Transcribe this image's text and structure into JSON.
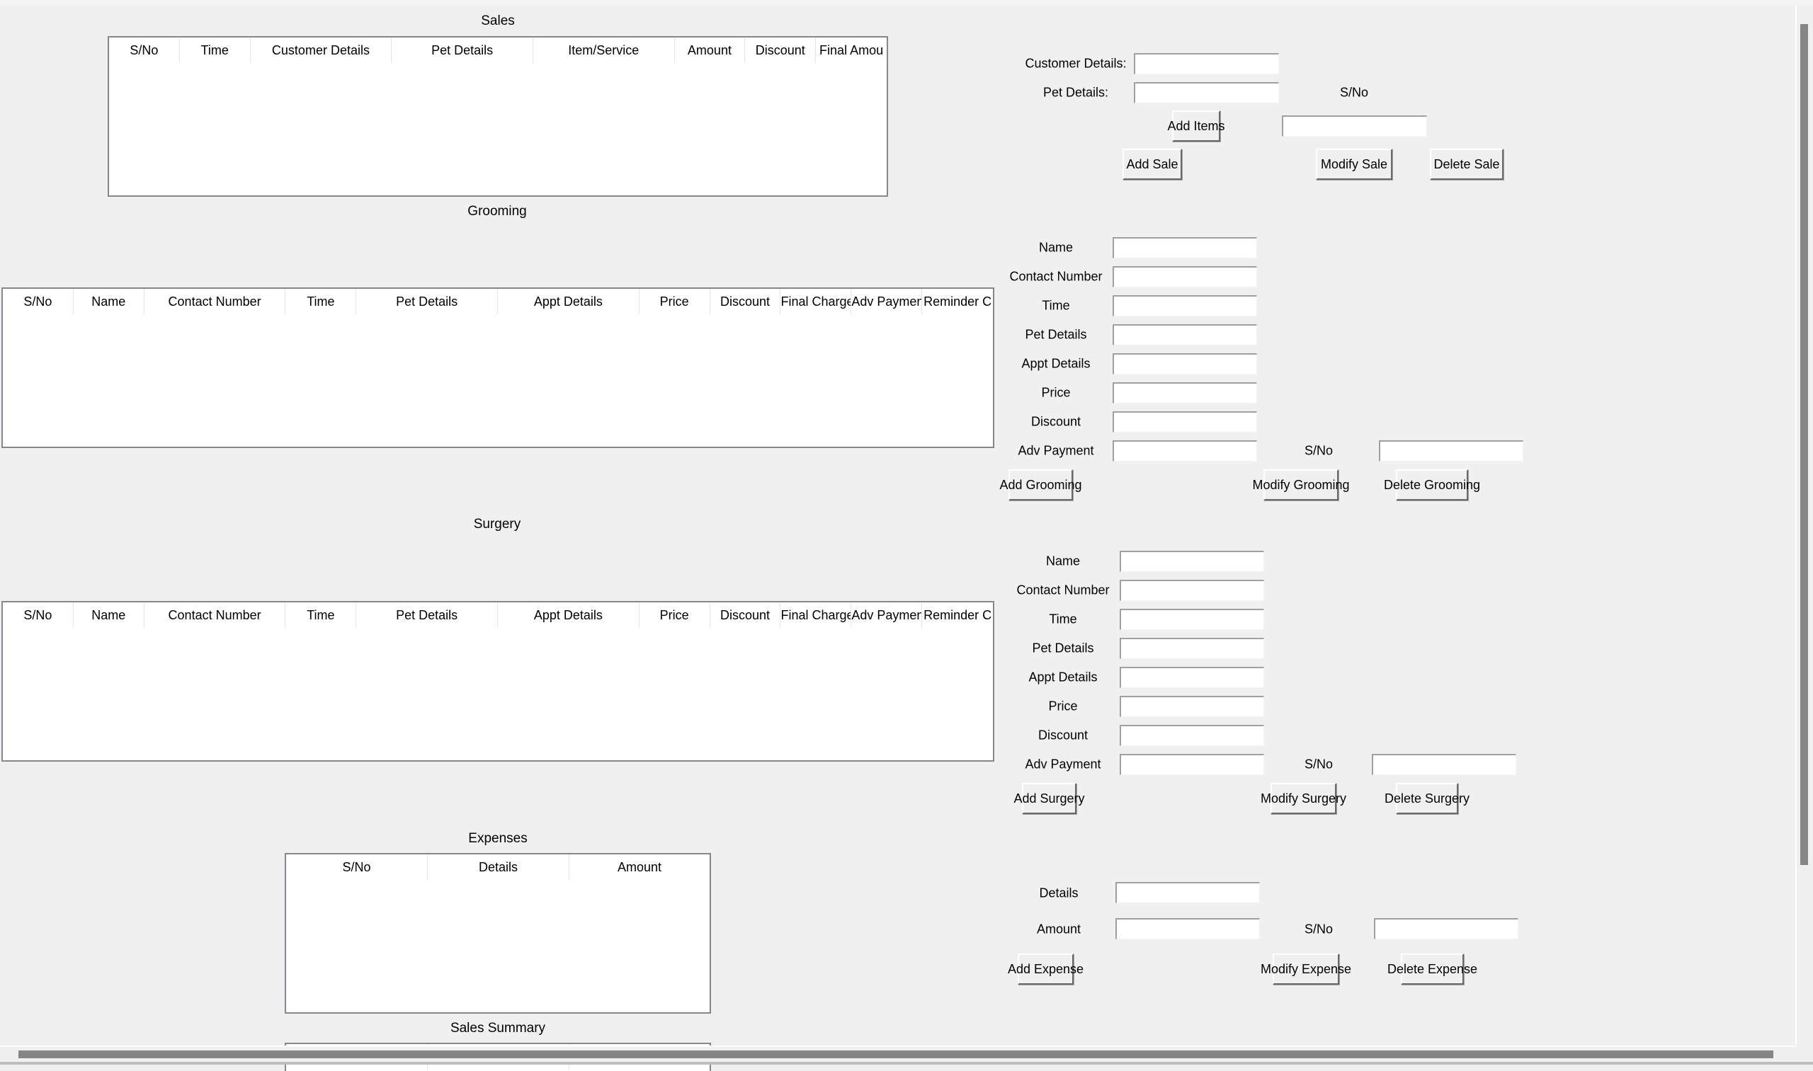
{
  "sales": {
    "title": "Sales",
    "columns": [
      "S/No",
      "Time",
      "Customer Details",
      "Pet Details",
      "Item/Service",
      "Amount",
      "Discount",
      "Final Amou"
    ],
    "rows": [],
    "form": {
      "customer_details_label": "Customer Details:",
      "customer_details_value": "",
      "pet_details_label": "Pet Details:",
      "pet_details_value": "",
      "sno_label": "S/No",
      "sno_value": "",
      "add_items_label": "Add Items",
      "add_label": "Add Sale",
      "modify_label": "Modify Sale",
      "delete_label": "Delete Sale"
    }
  },
  "grooming": {
    "title": "Grooming",
    "columns": [
      "S/No",
      "Name",
      "Contact Number",
      "Time",
      "Pet Details",
      "Appt Details",
      "Price",
      "Discount",
      "Final Charge",
      "Adv Payment",
      "Reminder C"
    ],
    "rows": [],
    "form": {
      "fields": [
        {
          "label": "Name",
          "value": ""
        },
        {
          "label": "Contact Number",
          "value": ""
        },
        {
          "label": "Time",
          "value": ""
        },
        {
          "label": "Pet Details",
          "value": ""
        },
        {
          "label": "Appt Details",
          "value": ""
        },
        {
          "label": "Price",
          "value": ""
        },
        {
          "label": "Discount",
          "value": ""
        },
        {
          "label": "Adv Payment",
          "value": ""
        }
      ],
      "sno_label": "S/No",
      "sno_value": "",
      "add_label": "Add Grooming",
      "modify_label": "Modify Grooming",
      "delete_label": "Delete Grooming"
    }
  },
  "surgery": {
    "title": "Surgery",
    "columns": [
      "S/No",
      "Name",
      "Contact Number",
      "Time",
      "Pet Details",
      "Appt Details",
      "Price",
      "Discount",
      "Final Charge",
      "Adv Payment",
      "Reminder C"
    ],
    "rows": [],
    "form": {
      "fields": [
        {
          "label": "Name",
          "value": ""
        },
        {
          "label": "Contact Number",
          "value": ""
        },
        {
          "label": "Time",
          "value": ""
        },
        {
          "label": "Pet Details",
          "value": ""
        },
        {
          "label": "Appt Details",
          "value": ""
        },
        {
          "label": "Price",
          "value": ""
        },
        {
          "label": "Discount",
          "value": ""
        },
        {
          "label": "Adv Payment",
          "value": ""
        }
      ],
      "sno_label": "S/No",
      "sno_value": "",
      "add_label": "Add Surgery",
      "modify_label": "Modify Surgery",
      "delete_label": "Delete Surgery"
    }
  },
  "expenses": {
    "title": "Expenses",
    "columns": [
      "S/No",
      "Details",
      "Amount"
    ],
    "rows": [],
    "form": {
      "details_label": "Details",
      "details_value": "",
      "amount_label": "Amount",
      "amount_value": "",
      "sno_label": "S/No",
      "sno_value": "",
      "add_label": "Add Expense",
      "modify_label": "Modify Expense",
      "delete_label": "Delete Expense"
    }
  },
  "sales_summary": {
    "title": "Sales Summary"
  },
  "colors": {
    "window_bg": "#f0f0f0",
    "table_border": "#828790",
    "scroll_thumb": "#858585"
  }
}
